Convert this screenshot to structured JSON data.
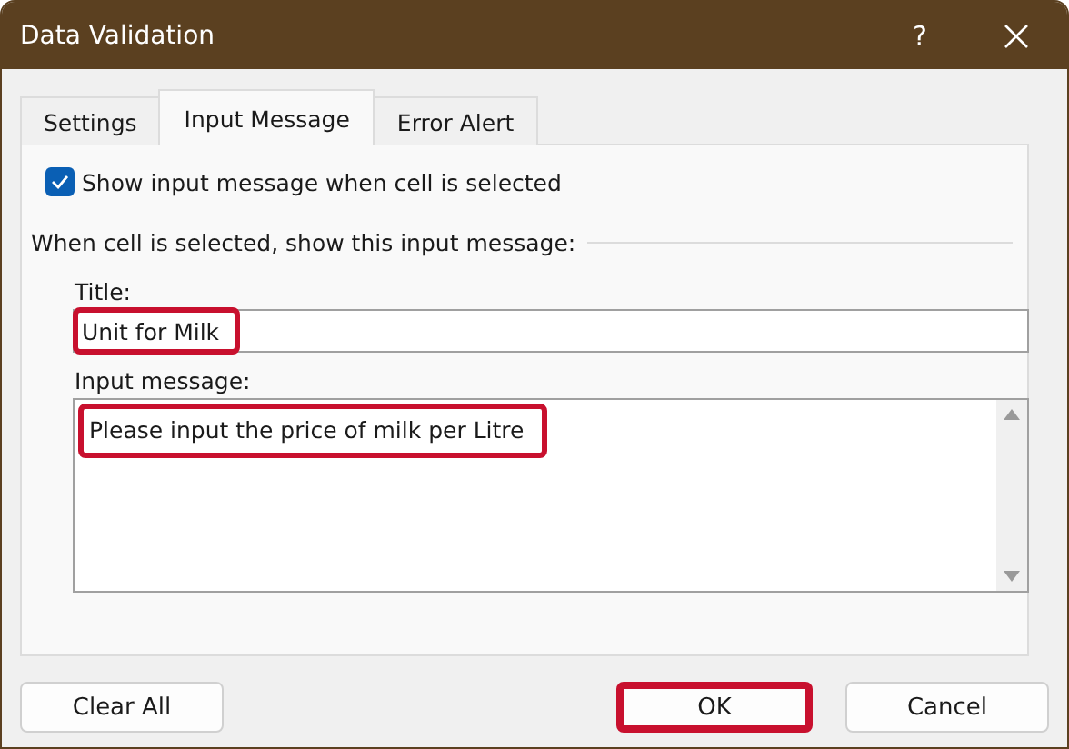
{
  "window": {
    "title": "Data Validation",
    "help": "?"
  },
  "tabs": [
    {
      "label": "Settings",
      "selected": false
    },
    {
      "label": "Input Message",
      "selected": true
    },
    {
      "label": "Error Alert",
      "selected": false
    }
  ],
  "show_message": {
    "label": "Show input message when cell is selected",
    "checked": true
  },
  "group_label": "When cell is selected, show this input message:",
  "title_field": {
    "label": "Title:",
    "value": "Unit for Milk",
    "highlighted": true
  },
  "message_field": {
    "label": "Input message:",
    "value": "Please input the price of milk per Litre",
    "highlighted": true
  },
  "buttons": [
    {
      "label": "Clear All",
      "highlighted": false
    },
    {
      "label": "OK",
      "highlighted": true
    },
    {
      "label": "Cancel",
      "highlighted": false
    }
  ]
}
